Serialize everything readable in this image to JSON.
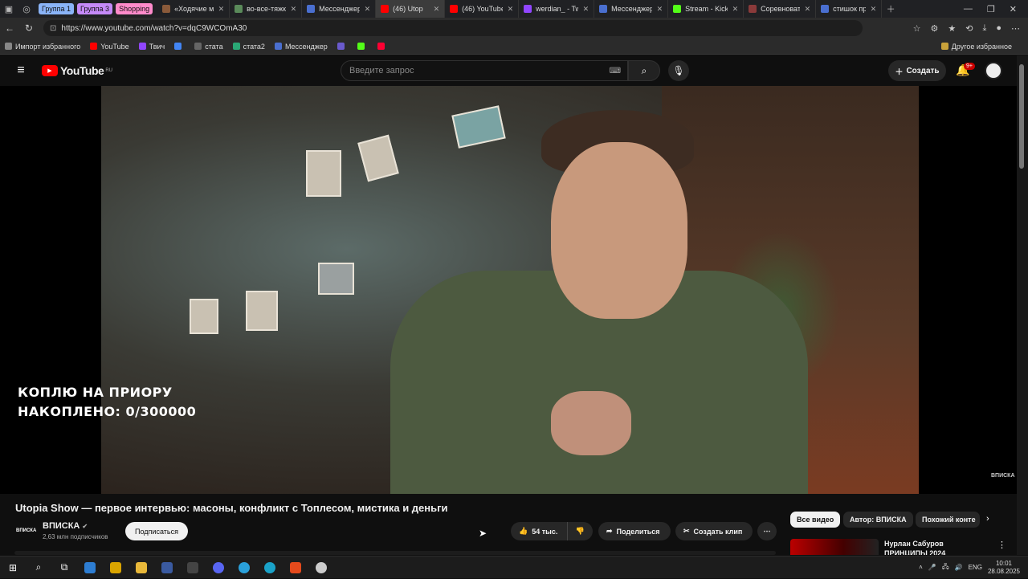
{
  "browser": {
    "groups": [
      {
        "label": "Группа 1",
        "color": "#8ab4f8"
      },
      {
        "label": "Группа 3",
        "color": "#c58af9"
      },
      {
        "label": "Shopping",
        "color": "#ff8bcb"
      }
    ],
    "tabs": [
      {
        "label": "«Ходячие мер",
        "color": "#8a5a3a"
      },
      {
        "label": "во-все-тяжки",
        "color": "#5a8a5a"
      },
      {
        "label": "Мессенджер",
        "color": "#4a6fd0"
      },
      {
        "label": "(46) Utop",
        "color": "#ff0000",
        "active": true
      },
      {
        "label": "(46) YouTube",
        "color": "#ff0000"
      },
      {
        "label": "werdian_ - Twi",
        "color": "#9146ff"
      },
      {
        "label": "Мессенджер",
        "color": "#4a6fd0"
      },
      {
        "label": "Stream - Kick",
        "color": "#53fc18"
      },
      {
        "label": "Соревновате",
        "color": "#8a3a3a"
      },
      {
        "label": "стишок про р",
        "color": "#4a6fd0"
      }
    ],
    "url": "https://www.youtube.com/watch?v=dqC9WCOmA30",
    "bookmarks": [
      {
        "label": "Импорт избранного",
        "color": "#888888"
      },
      {
        "label": "YouTube",
        "color": "#ff0000"
      },
      {
        "label": "Твич",
        "color": "#9146ff"
      },
      {
        "label": "",
        "color": "#4285f4"
      },
      {
        "label": "стата",
        "color": "#666666"
      },
      {
        "label": "стата2",
        "color": "#2aa876"
      },
      {
        "label": "Мессенджер",
        "color": "#4a6fd0"
      },
      {
        "label": "",
        "color": "#6a5acd"
      },
      {
        "label": "",
        "color": "#53fc18"
      },
      {
        "label": "",
        "color": "#ff0033"
      }
    ],
    "other_bookmarks": "Другое избранное"
  },
  "youtube": {
    "logo_text": "YouTube",
    "logo_region": "RU",
    "search_placeholder": "Введите запрос",
    "create_label": "Создать",
    "notifications_badge": "9+"
  },
  "video": {
    "overlay_line1": "КОПЛЮ НА ПРИОРУ",
    "overlay_line2": "НАКОПЛЕНО: 0/300000",
    "watermark": "ВПИСКА",
    "title": "Utopia Show — первое интервью: масоны, конфликт с Топлесом, мистика и деньги",
    "channel_name": "ВПИСКА",
    "channel_logo": "ВПИСКА",
    "subscribers": "2,63 млн подписчиков",
    "subscribe_label": "Подписаться",
    "likes": "54 тыс.",
    "share_label": "Поделиться",
    "clip_label": "Создать клип"
  },
  "sidebar": {
    "chips": [
      "Все видео",
      "Автор: ВПИСКА",
      "Похожий конте"
    ],
    "recommendation_title": "Нурлан Сабуров ПРИНЦИПЫ 2024"
  },
  "taskbar": {
    "lang": "ENG",
    "time": "10:01",
    "date": "28.08.2025"
  }
}
